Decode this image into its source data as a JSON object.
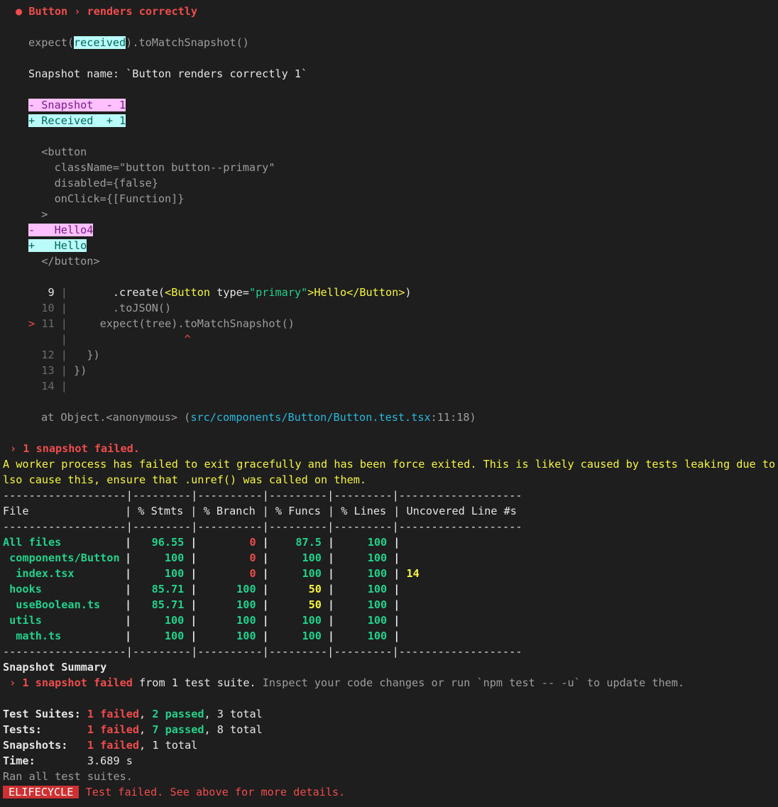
{
  "header": {
    "bullet": "●",
    "title": "Button › renders correctly"
  },
  "expect_line": {
    "pre": "expect(",
    "received": "received",
    "post": ").toMatchSnapshot()"
  },
  "snapshot_name": "Snapshot name: `Button renders correctly 1`",
  "legend": {
    "minus": "- Snapshot  - 1",
    "plus": "+ Received  + 1"
  },
  "snapshot_body": [
    "  <button",
    "    className=\"button button--primary\"",
    "    disabled={false}",
    "    onClick={[Function]}",
    "  >"
  ],
  "diff_minus": {
    "prefix": "-   ",
    "text": "Hello4"
  },
  "diff_plus": {
    "prefix": "+   ",
    "text": "Hello"
  },
  "snapshot_close": "  </button>",
  "code": {
    "l9": {
      "num": "9",
      "pre": "       .create(",
      "tag_open": "<Button",
      "attr": " type=",
      "value": "\"primary\"",
      "tag_mid": ">Hello</Button>",
      "post": ")"
    },
    "l10": {
      "num": "10",
      "text": "       .toJSON()"
    },
    "l11": {
      "marker": ">",
      "num": "11",
      "text": "     expect(tree).toMatchSnapshot()"
    },
    "caret": "^",
    "l12": {
      "num": "12",
      "text": "   })"
    },
    "l13": {
      "num": "13",
      "text": " })"
    },
    "l14": {
      "num": "14",
      "text": ""
    },
    "sep": "|"
  },
  "stack": {
    "pre": "at Object.<anonymous> (",
    "path": "src/components/Button/Button.test.tsx",
    "loc": ":11:18)"
  },
  "summary_fail": "› 1 snapshot failed.",
  "worker_warning": [
    "A worker process has failed to exit gracefully and has been force exited. This is likely caused by tests leaking due to im",
    "lso cause this, ensure that .unref() was called on them."
  ],
  "coverage": {
    "border": "-------------------|---------|----------|---------|---------|-------------------",
    "headers": [
      "File",
      "% Stmts",
      "% Branch",
      "% Funcs",
      "% Lines",
      "Uncovered Line #s"
    ],
    "rows": [
      {
        "file": "All files",
        "indent": 0,
        "stmts": "96.55",
        "branch": "0",
        "funcs": "87.5",
        "lines": "100",
        "uncovered": "",
        "stmts_c": "green",
        "branch_c": "red",
        "funcs_c": "green",
        "lines_c": "green"
      },
      {
        "file": "components/Button",
        "indent": 1,
        "stmts": "100",
        "branch": "0",
        "funcs": "100",
        "lines": "100",
        "uncovered": "",
        "stmts_c": "green",
        "branch_c": "red",
        "funcs_c": "green",
        "lines_c": "green"
      },
      {
        "file": "index.tsx",
        "indent": 2,
        "stmts": "100",
        "branch": "0",
        "funcs": "100",
        "lines": "100",
        "uncovered": "14",
        "stmts_c": "green",
        "branch_c": "red",
        "funcs_c": "green",
        "lines_c": "green"
      },
      {
        "file": "hooks",
        "indent": 1,
        "stmts": "85.71",
        "branch": "100",
        "funcs": "50",
        "lines": "100",
        "uncovered": "",
        "stmts_c": "green",
        "branch_c": "green",
        "funcs_c": "yellow",
        "lines_c": "green"
      },
      {
        "file": "useBoolean.ts",
        "indent": 2,
        "stmts": "85.71",
        "branch": "100",
        "funcs": "50",
        "lines": "100",
        "uncovered": "",
        "stmts_c": "green",
        "branch_c": "green",
        "funcs_c": "yellow",
        "lines_c": "green"
      },
      {
        "file": "utils",
        "indent": 1,
        "stmts": "100",
        "branch": "100",
        "funcs": "100",
        "lines": "100",
        "uncovered": "",
        "stmts_c": "green",
        "branch_c": "green",
        "funcs_c": "green",
        "lines_c": "green"
      },
      {
        "file": "math.ts",
        "indent": 2,
        "stmts": "100",
        "branch": "100",
        "funcs": "100",
        "lines": "100",
        "uncovered": "",
        "stmts_c": "green",
        "branch_c": "green",
        "funcs_c": "green",
        "lines_c": "green"
      }
    ]
  },
  "snapshot_summary": {
    "title": "Snapshot Summary",
    "fail": " › 1 snapshot failed",
    "from": " from 1 test suite.",
    "hint": " Inspect your code changes or run `npm test -- -u` to update them."
  },
  "results": {
    "suites": {
      "label": "Test Suites: ",
      "failed": "1 failed",
      "sep1": ", ",
      "passed": "2 passed",
      "rest": ", 3 total"
    },
    "tests": {
      "label": "Tests:       ",
      "failed": "1 failed",
      "sep1": ", ",
      "passed": "7 passed",
      "rest": ", 8 total"
    },
    "snapshots": {
      "label": "Snapshots:   ",
      "failed": "1 failed",
      "rest": ", 1 total"
    },
    "time": {
      "label": "Time:        ",
      "value": "3.689 s"
    }
  },
  "ran_all": "Ran all test suites.",
  "elifecycle": {
    "badge": "ELIFECYCLE",
    "message": " Test failed. See above for more details."
  },
  "colors": {
    "background": "#1e1e1e",
    "red": "#f14c4c",
    "green": "#23d18b",
    "yellow": "#f5f543"
  }
}
